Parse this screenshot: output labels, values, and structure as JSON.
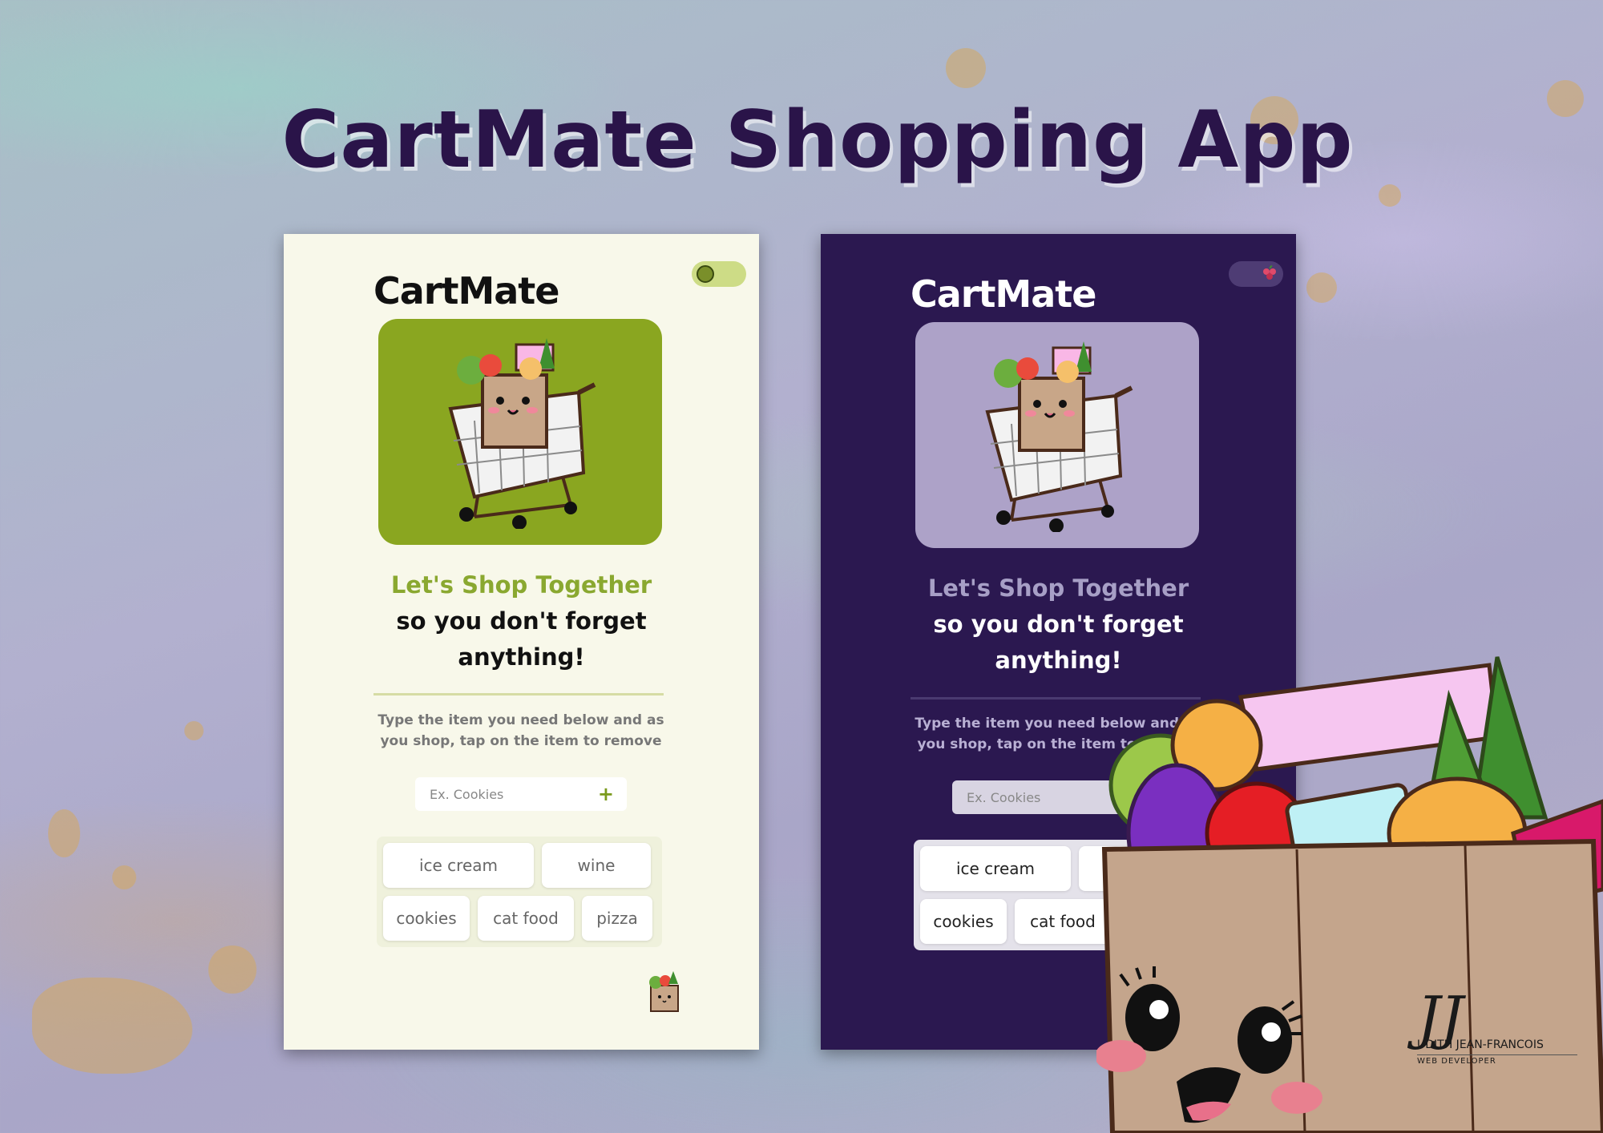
{
  "banner": {
    "title": "CartMate Shopping App"
  },
  "screens": {
    "light": {
      "brand": "CartMate",
      "tagline_accent": "Let's Shop Together",
      "tagline_main": "so you don't forget anything!",
      "instructions": "Type the item you need below and as you shop, tap on the item to remove",
      "input_placeholder": "Ex. Cookies",
      "add_label": "+",
      "items": [
        "ice cream",
        "wine",
        "cookies",
        "cat food",
        "pizza"
      ],
      "theme_icon": "kiwi-icon"
    },
    "dark": {
      "brand": "CartMate",
      "tagline_accent": "Let's Shop Together",
      "tagline_main": "so you don't forget anything!",
      "instructions": "Type the item you need below and as you shop, tap on the item to remove",
      "input_placeholder": "Ex. Cookies",
      "items": [
        "ice cream",
        "cookies",
        "cat food"
      ],
      "theme_icon": "grapes-icon"
    }
  },
  "signature": {
    "initials": "JJ",
    "name": "UDITH JEAN-FRANCOIS",
    "role": "WEB DEVELOPER"
  },
  "colors": {
    "title": "#2a1449",
    "light_bg": "#f8f8ea",
    "dark_bg": "#2b1850",
    "light_hero": "#8aa620",
    "dark_hero": "#ada2c8",
    "accent_green": "#8aa830"
  }
}
